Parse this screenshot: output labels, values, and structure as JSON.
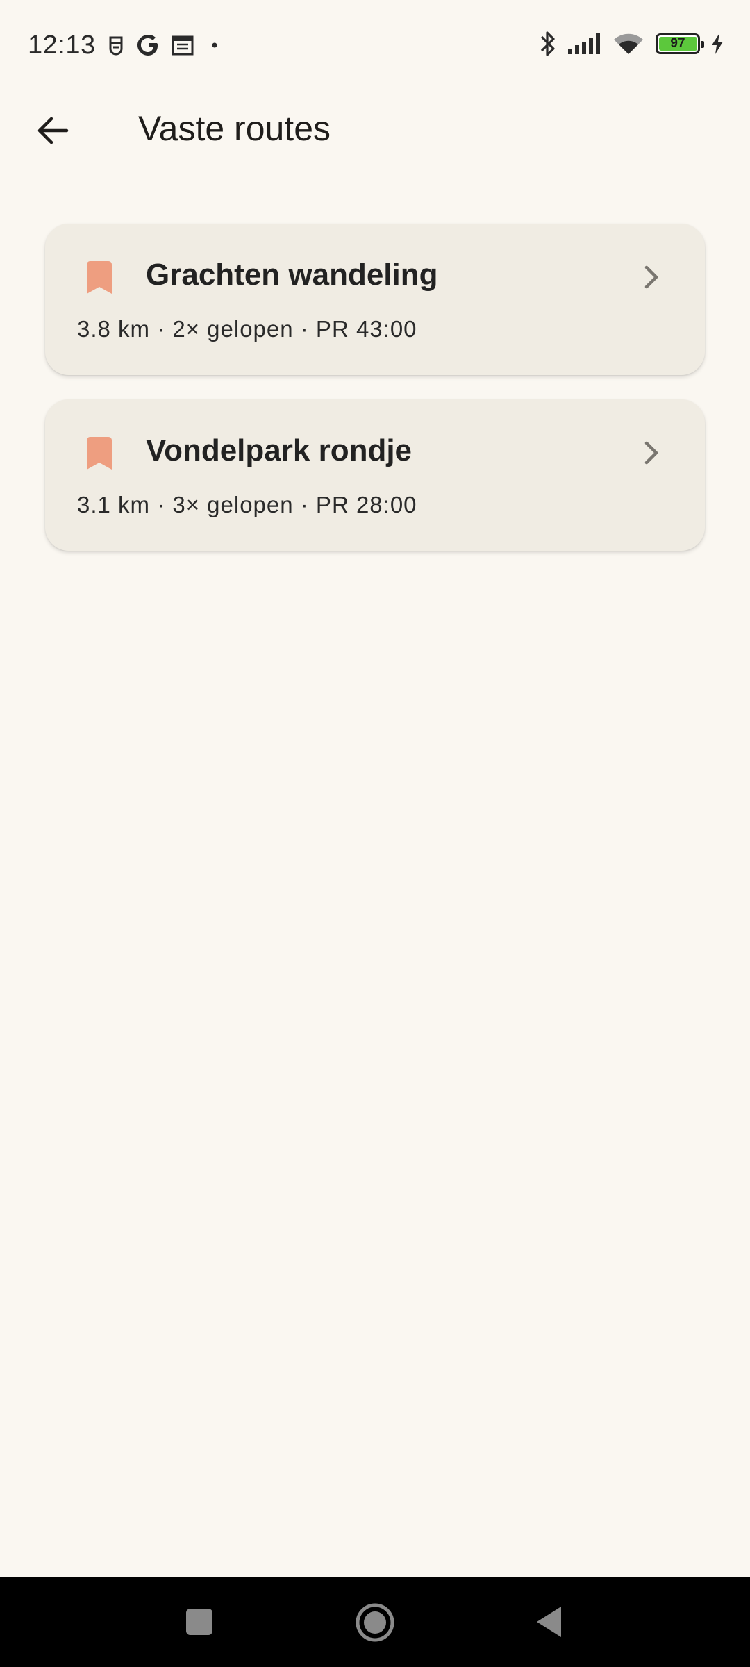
{
  "status_bar": {
    "time": "12:13",
    "battery_level": 97,
    "battery_label": "97",
    "icons": [
      "notification-icon",
      "google-icon",
      "calendar-icon",
      "dot-icon",
      "bluetooth-icon",
      "signal-icon",
      "wifi-icon",
      "battery-icon",
      "charging-icon"
    ],
    "colors": {
      "battery_fill": "#5CC83C"
    }
  },
  "app_bar": {
    "back_icon": "arrow-back-icon",
    "title": "Vaste routes"
  },
  "routes": [
    {
      "name": "Grachten wandeling",
      "meta": "3.8 km · 2× gelopen · PR 43:00",
      "icon": "bookmark-icon"
    },
    {
      "name": "Vondelpark rondje",
      "meta": "3.1 km · 3× gelopen · PR 28:00",
      "icon": "bookmark-icon"
    }
  ],
  "colors": {
    "background": "#FAF7F1",
    "card": "#F0ECE3",
    "accent": "#EE9E80",
    "text": "#1F1D1B"
  },
  "nav_bar": {
    "buttons": [
      "recents-button",
      "home-button",
      "back-button"
    ]
  }
}
